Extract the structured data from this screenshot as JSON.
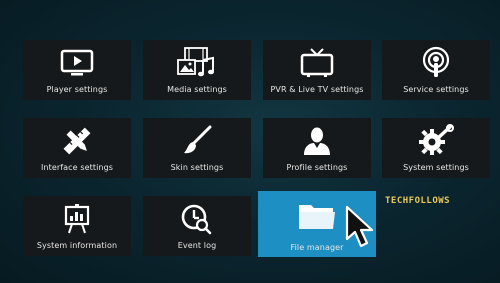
{
  "tiles": [
    {
      "label": "Player settings",
      "icon": "monitor-play-icon"
    },
    {
      "label": "Media settings",
      "icon": "media-icon"
    },
    {
      "label": "PVR & Live TV settings",
      "icon": "tv-icon"
    },
    {
      "label": "Service settings",
      "icon": "podcast-icon"
    },
    {
      "label": "Interface settings",
      "icon": "pencil-ruler-icon"
    },
    {
      "label": "Skin settings",
      "icon": "paintbrush-icon"
    },
    {
      "label": "Profile settings",
      "icon": "user-icon"
    },
    {
      "label": "System settings",
      "icon": "gear-wrench-icon"
    },
    {
      "label": "System information",
      "icon": "presentation-board-icon"
    },
    {
      "label": "Event log",
      "icon": "clock-search-icon"
    },
    {
      "label": "File manager",
      "icon": "folder-icon",
      "selected": true
    }
  ],
  "watermark": "TECHFOLLOWS",
  "colors": {
    "tile_bg": "#16191b",
    "selected_bg": "#1d8fc2",
    "text": "#e6e6e6"
  }
}
